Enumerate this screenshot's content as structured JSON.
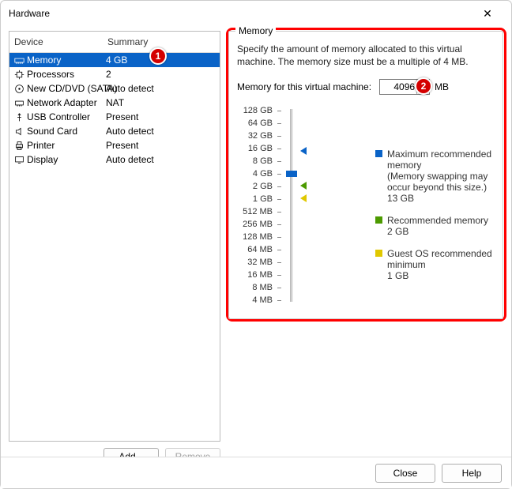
{
  "window": {
    "title": "Hardware"
  },
  "deviceList": {
    "headers": {
      "device": "Device",
      "summary": "Summary"
    },
    "items": [
      {
        "icon": "memory",
        "name": "Memory",
        "summary": "4 GB",
        "selected": true
      },
      {
        "icon": "cpu",
        "name": "Processors",
        "summary": "2",
        "selected": false
      },
      {
        "icon": "disc",
        "name": "New CD/DVD (SATA)",
        "summary": "Auto detect",
        "selected": false
      },
      {
        "icon": "net",
        "name": "Network Adapter",
        "summary": "NAT",
        "selected": false
      },
      {
        "icon": "usb",
        "name": "USB Controller",
        "summary": "Present",
        "selected": false
      },
      {
        "icon": "sound",
        "name": "Sound Card",
        "summary": "Auto detect",
        "selected": false
      },
      {
        "icon": "printer",
        "name": "Printer",
        "summary": "Present",
        "selected": false
      },
      {
        "icon": "display",
        "name": "Display",
        "summary": "Auto detect",
        "selected": false
      }
    ]
  },
  "buttons": {
    "add": "Add...",
    "remove": "Remove",
    "close": "Close",
    "help": "Help"
  },
  "memory": {
    "groupLabel": "Memory",
    "description": "Specify the amount of memory allocated to this virtual machine. The memory size must be a multiple of 4 MB.",
    "inputLabel": "Memory for this virtual machine:",
    "value": "4096",
    "unit": "MB",
    "ticks": [
      "128 GB",
      "64 GB",
      "32 GB",
      "16 GB",
      "8 GB",
      "4 GB",
      "2 GB",
      "1 GB",
      "512 MB",
      "256 MB",
      "128 MB",
      "64 MB",
      "32 MB",
      "16 MB",
      "8 MB",
      "4 MB"
    ],
    "legend": {
      "max": {
        "title": "Maximum recommended memory",
        "note": "(Memory swapping may occur beyond this size.)",
        "value": "13 GB"
      },
      "rec": {
        "title": "Recommended memory",
        "value": "2 GB"
      },
      "min": {
        "title": "Guest OS recommended minimum",
        "value": "1 GB"
      }
    }
  },
  "callouts": {
    "one": "1",
    "two": "2"
  }
}
